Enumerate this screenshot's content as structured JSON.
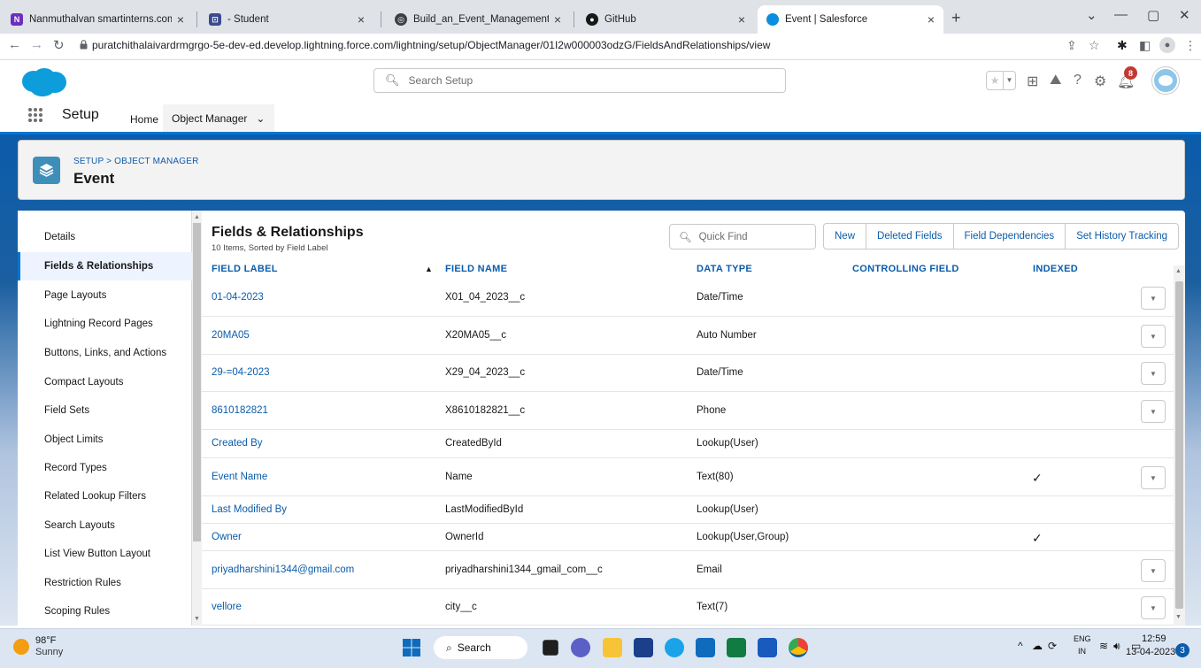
{
  "browser": {
    "tabs": [
      {
        "title": "Nanmuthalvan smartinterns.com",
        "favicon_color": "#6b2fbf"
      },
      {
        "title": "- Student",
        "favicon_color": "#3c4b8e"
      },
      {
        "title": "Build_an_Event_Management_Sy",
        "favicon_color": "#3c4043"
      },
      {
        "title": "GitHub",
        "favicon_color": "#181818"
      },
      {
        "title": "Event | Salesforce",
        "favicon_color": "#0b8ee0"
      }
    ],
    "url": "puratchithalaivardrmgrgo-5e-dev-ed.develop.lightning.force.com/lightning/setup/ObjectManager/01I2w000003odzG/FieldsAndRelationships/view"
  },
  "sf": {
    "search_placeholder": "Search Setup",
    "notification_count": "8",
    "app_name": "Setup",
    "nav": [
      "Home",
      "Object Manager"
    ],
    "breadcrumb": "SETUP > OBJECT MANAGER",
    "object_name": "Event"
  },
  "sidebar": {
    "items": [
      "Details",
      "Fields & Relationships",
      "Page Layouts",
      "Lightning Record Pages",
      "Buttons, Links, and Actions",
      "Compact Layouts",
      "Field Sets",
      "Object Limits",
      "Record Types",
      "Related Lookup Filters",
      "Search Layouts",
      "List View Button Layout",
      "Restriction Rules",
      "Scoping Rules"
    ],
    "active_index": 1
  },
  "section": {
    "title": "Fields & Relationships",
    "subtitle": "10 Items, Sorted by Field Label",
    "quick_find_placeholder": "Quick Find",
    "buttons": [
      "New",
      "Deleted Fields",
      "Field Dependencies",
      "Set History Tracking"
    ]
  },
  "table": {
    "columns": [
      "FIELD LABEL",
      "FIELD NAME",
      "DATA TYPE",
      "CONTROLLING FIELD",
      "INDEXED"
    ],
    "rows": [
      {
        "label": "01-04-2023",
        "name": "X01_04_2023__c",
        "type": "Date/Time",
        "indexed": false,
        "menu": true
      },
      {
        "label": "20MA05",
        "name": "X20MA05__c",
        "type": "Auto Number",
        "indexed": false,
        "menu": true
      },
      {
        "label": "29-=04-2023",
        "name": "X29_04_2023__c",
        "type": "Date/Time",
        "indexed": false,
        "menu": true
      },
      {
        "label": "8610182821",
        "name": "X8610182821__c",
        "type": "Phone",
        "indexed": false,
        "menu": true
      },
      {
        "label": "Created By",
        "name": "CreatedById",
        "type": "Lookup(User)",
        "indexed": false,
        "menu": false
      },
      {
        "label": "Event Name",
        "name": "Name",
        "type": "Text(80)",
        "indexed": true,
        "menu": true
      },
      {
        "label": "Last Modified By",
        "name": "LastModifiedById",
        "type": "Lookup(User)",
        "indexed": false,
        "menu": false
      },
      {
        "label": "Owner",
        "name": "OwnerId",
        "type": "Lookup(User,Group)",
        "indexed": true,
        "menu": false
      },
      {
        "label": "priyadharshini1344@gmail.com",
        "name": "priyadharshini1344_gmail_com__c",
        "type": "Email",
        "indexed": false,
        "menu": true
      },
      {
        "label": "vellore",
        "name": "city__c",
        "type": "Text(7)",
        "indexed": false,
        "menu": true
      }
    ]
  },
  "taskbar": {
    "temperature": "98°F",
    "weather": "Sunny",
    "search_label": "Search",
    "lang": "ENG",
    "region": "IN",
    "time": "12:59",
    "date": "13-04-2023",
    "notification_count": "3"
  }
}
